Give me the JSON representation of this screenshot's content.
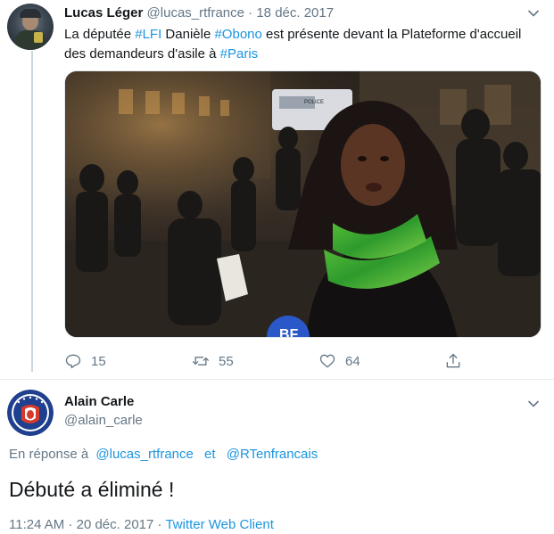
{
  "tweet1": {
    "name": "Lucas Léger",
    "handle": "@lucas_rtfrance",
    "separator": "·",
    "date": "18 déc. 2017",
    "text": {
      "p1": "La députée ",
      "tag1": "#LFI",
      "p2": " Danièle ",
      "tag2": "#Obono",
      "p3": " est présente devant la Plateforme d'accueil des demandeurs d'asile à ",
      "tag3": "#Paris"
    },
    "media": {
      "van_label": "POLICE",
      "mic_label": "BF"
    },
    "actions": {
      "replies": "15",
      "retweets": "55",
      "likes": "64"
    }
  },
  "tweet2": {
    "name": "Alain Carle",
    "handle": "@alain_carle",
    "reply_prefix": "En réponse à",
    "reply_to_1": "@lucas_rtfrance",
    "reply_and": "et",
    "reply_to_2": "@RTenfrancais",
    "text": "Débuté a éliminé !",
    "time": "11:24 AM",
    "separator": "·",
    "date": "20 déc. 2017",
    "separator2": "·",
    "client": "Twitter Web Client"
  },
  "colors": {
    "link": "#1b95e0",
    "muted": "#657786",
    "text": "#14171a"
  },
  "icons": {
    "reply": "reply-icon",
    "retweet": "retweet-icon",
    "like": "heart-icon",
    "share": "share-icon",
    "more": "chevron-down-icon"
  }
}
